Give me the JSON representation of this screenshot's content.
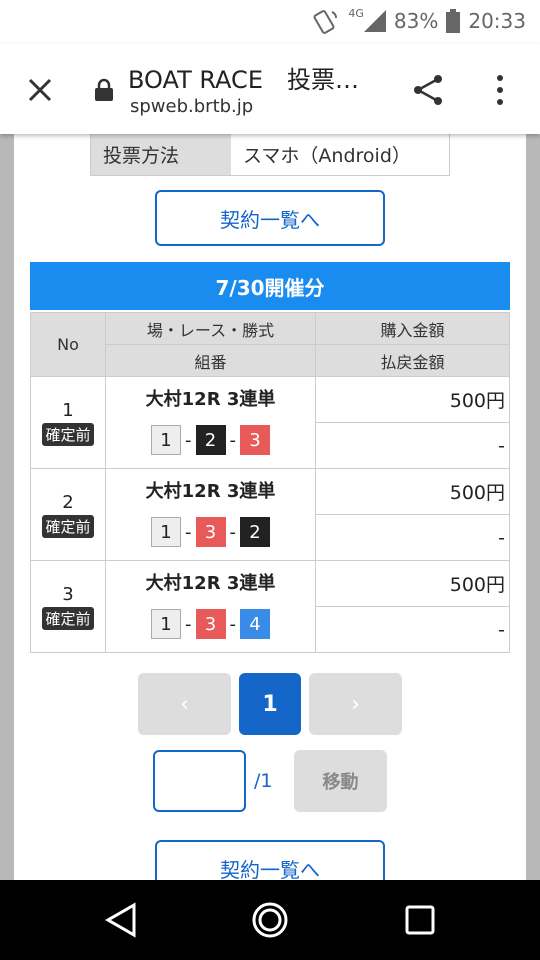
{
  "status": {
    "signal": "4G",
    "battery": "83%",
    "time": "20:33"
  },
  "browser": {
    "title": "BOAT RACE　投票…",
    "url": "spweb.brtb.jp"
  },
  "vote_method": {
    "label": "投票方法",
    "value": "スマホ（Android）"
  },
  "contract_list_button": "契約一覧へ",
  "date_header": "7/30開催分",
  "table": {
    "headers": {
      "no": "No",
      "race": "場・レース・勝式",
      "combo": "組番",
      "purchase": "購入金額",
      "payout": "払戻金額"
    },
    "rows": [
      {
        "no": "1",
        "status": "確定前",
        "race": "大村12R 3連単",
        "combo": [
          "1",
          "2",
          "3"
        ],
        "purchase": "500円",
        "payout": "-"
      },
      {
        "no": "2",
        "status": "確定前",
        "race": "大村12R 3連単",
        "combo": [
          "1",
          "3",
          "2"
        ],
        "purchase": "500円",
        "payout": "-"
      },
      {
        "no": "3",
        "status": "確定前",
        "race": "大村12R 3連単",
        "combo": [
          "1",
          "3",
          "4"
        ],
        "purchase": "500円",
        "payout": "-"
      }
    ]
  },
  "pager": {
    "prev": "‹",
    "current": "1",
    "next": "›"
  },
  "jump": {
    "total": "/1",
    "button": "移動"
  },
  "colors": {
    "accent": "#1466c8",
    "header": "#1a8cf0"
  }
}
